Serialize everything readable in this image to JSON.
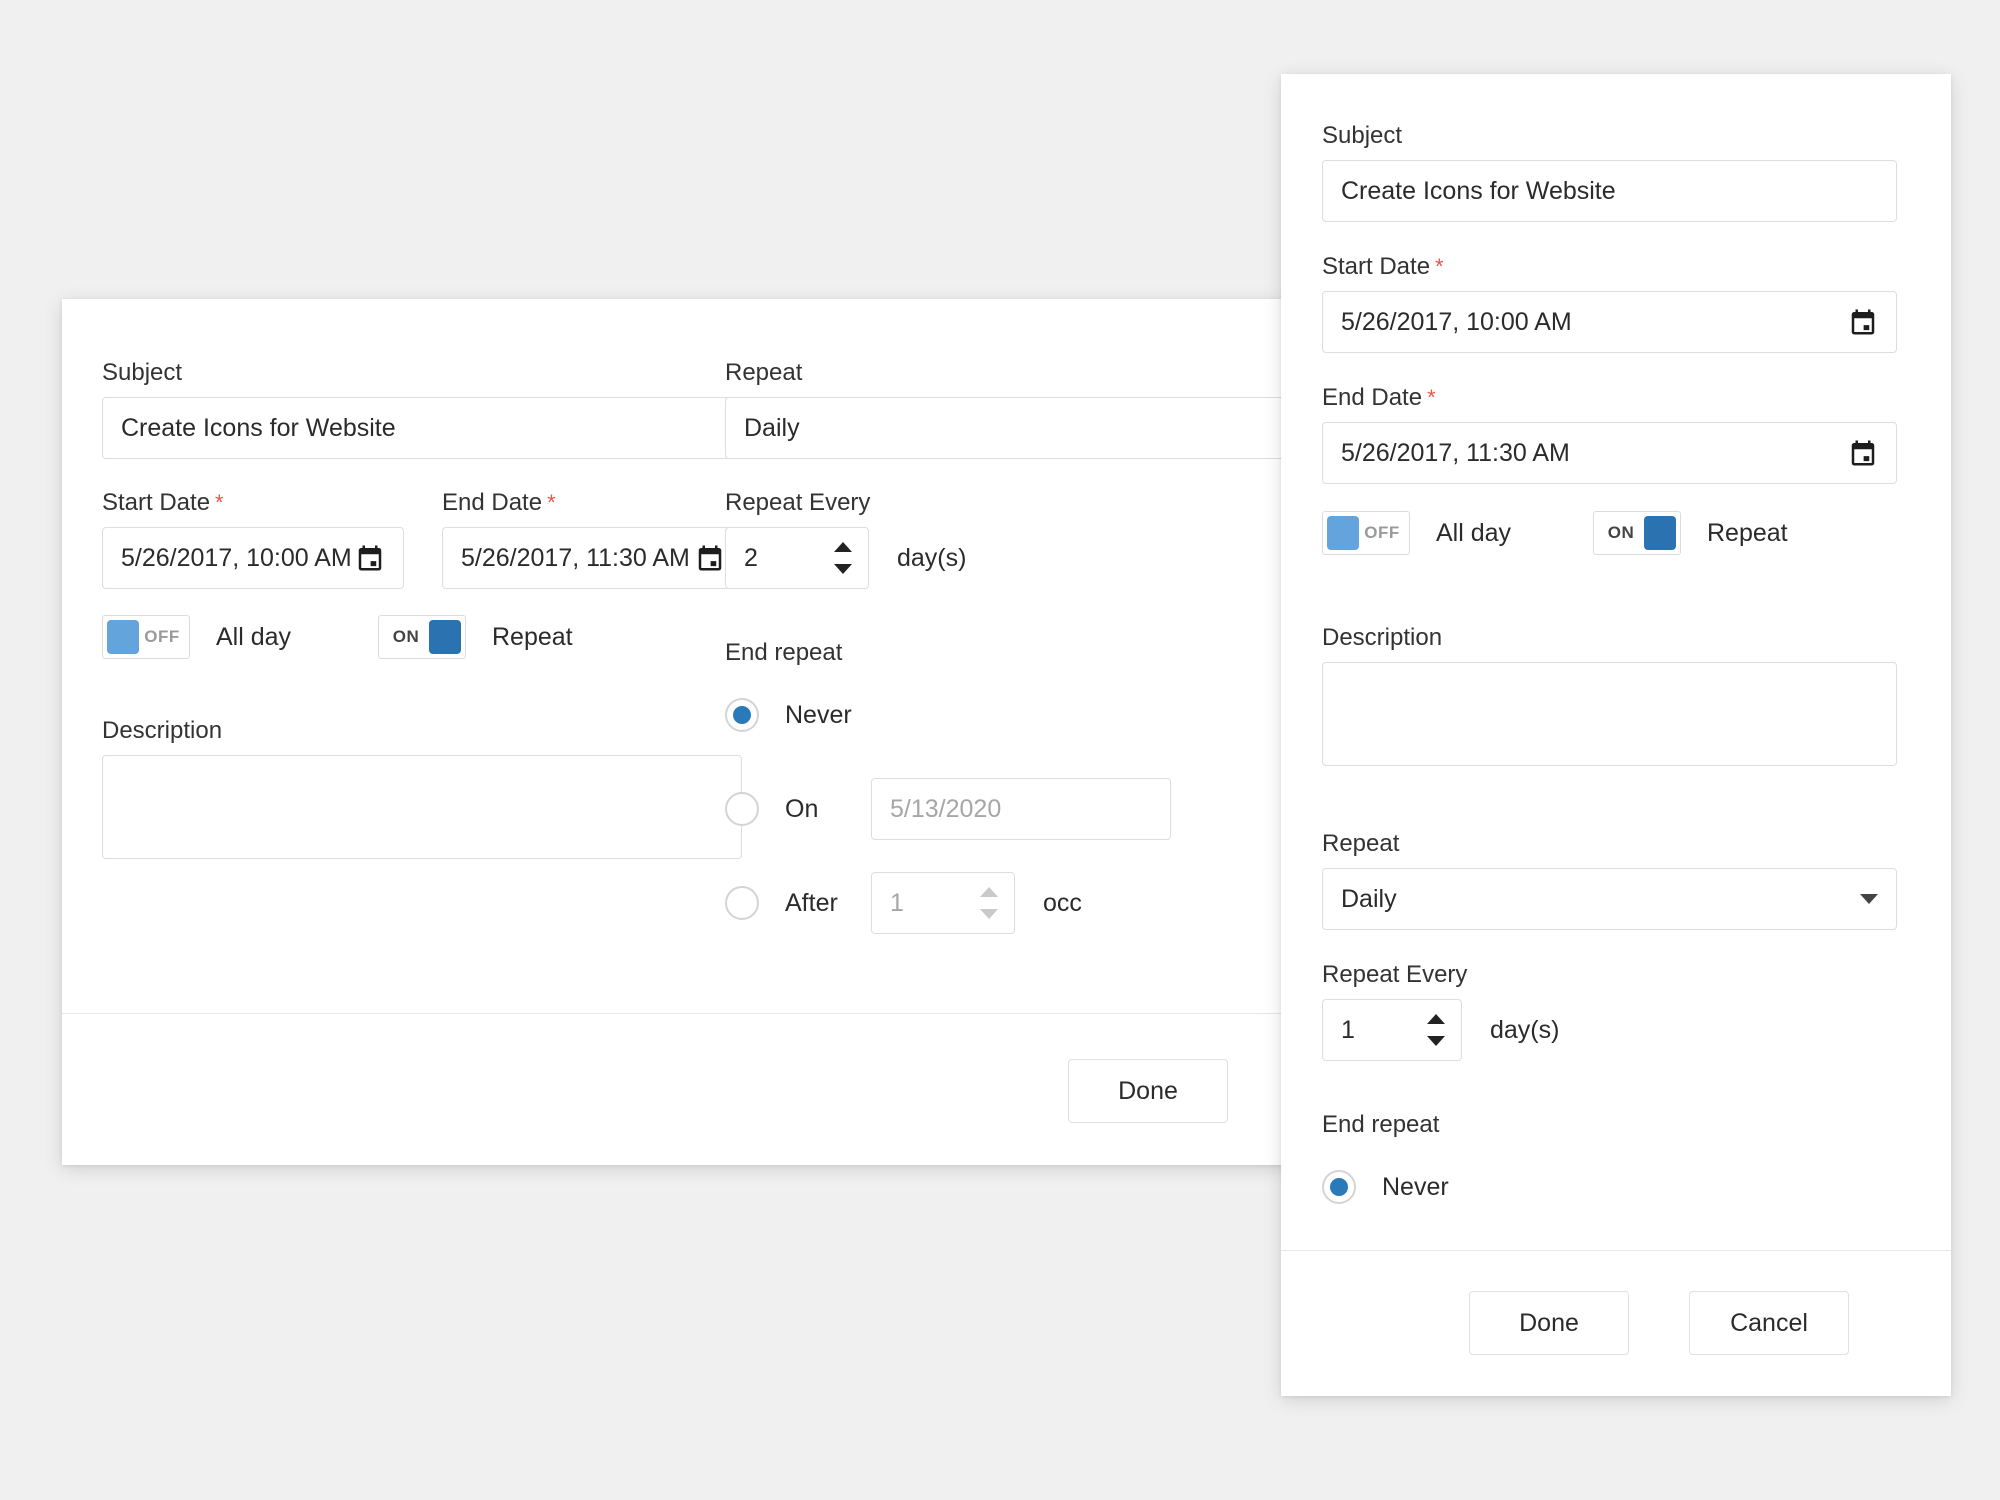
{
  "dialogs": {
    "back": {
      "subject": {
        "label": "Subject",
        "value": "Create Icons for Website"
      },
      "start_date": {
        "label": "Start Date",
        "required_mark": "*",
        "value": "5/26/2017, 10:00 AM",
        "icon": "calendar-icon"
      },
      "end_date": {
        "label": "End Date",
        "required_mark": "*",
        "value": "5/26/2017, 11:30 AM",
        "icon": "calendar-icon"
      },
      "all_day": {
        "state": "OFF",
        "label": "All day",
        "on": false
      },
      "repeat_toggle": {
        "state": "ON",
        "label": "Repeat",
        "on": true
      },
      "description": {
        "label": "Description",
        "value": ""
      },
      "repeat": {
        "label": "Repeat",
        "value": "Daily"
      },
      "repeat_every": {
        "label": "Repeat Every",
        "value": "2",
        "unit": "day(s)"
      },
      "end_repeat": {
        "label": "End repeat",
        "options": [
          {
            "label": "Never",
            "selected": true
          },
          {
            "label": "On",
            "selected": false,
            "date_value": "5/13/2020"
          },
          {
            "label": "After",
            "selected": false,
            "count_value": "1",
            "unit": "occ"
          }
        ]
      },
      "footer": {
        "done_label": "Done"
      }
    },
    "front": {
      "subject": {
        "label": "Subject",
        "value": "Create Icons for Website"
      },
      "start_date": {
        "label": "Start Date",
        "required_mark": "*",
        "value": "5/26/2017, 10:00 AM",
        "icon": "calendar-icon"
      },
      "end_date": {
        "label": "End Date",
        "required_mark": "*",
        "value": "5/26/2017, 11:30 AM",
        "icon": "calendar-icon"
      },
      "all_day": {
        "state": "OFF",
        "label": "All day",
        "on": false
      },
      "repeat_toggle": {
        "state": "ON",
        "label": "Repeat",
        "on": true
      },
      "description": {
        "label": "Description",
        "value": ""
      },
      "repeat": {
        "label": "Repeat",
        "value": "Daily",
        "icon": "chevron-down-icon"
      },
      "repeat_every": {
        "label": "Repeat Every",
        "value": "1",
        "unit": "day(s)"
      },
      "end_repeat": {
        "label": "End repeat",
        "options": [
          {
            "label": "Never",
            "selected": true
          }
        ]
      },
      "footer": {
        "done_label": "Done",
        "cancel_label": "Cancel"
      }
    }
  },
  "colors": {
    "page_background": "#f0f0f0",
    "dialog_background": "#ffffff",
    "required_star": "#e8564a",
    "toggle_off_thumb": "#64a4dd",
    "toggle_on_thumb": "#2b72b0",
    "radio_selected": "#2a7ab9",
    "border": "#dddddd",
    "text": "#2b2b2b",
    "placeholder": "#a6a6a6"
  }
}
